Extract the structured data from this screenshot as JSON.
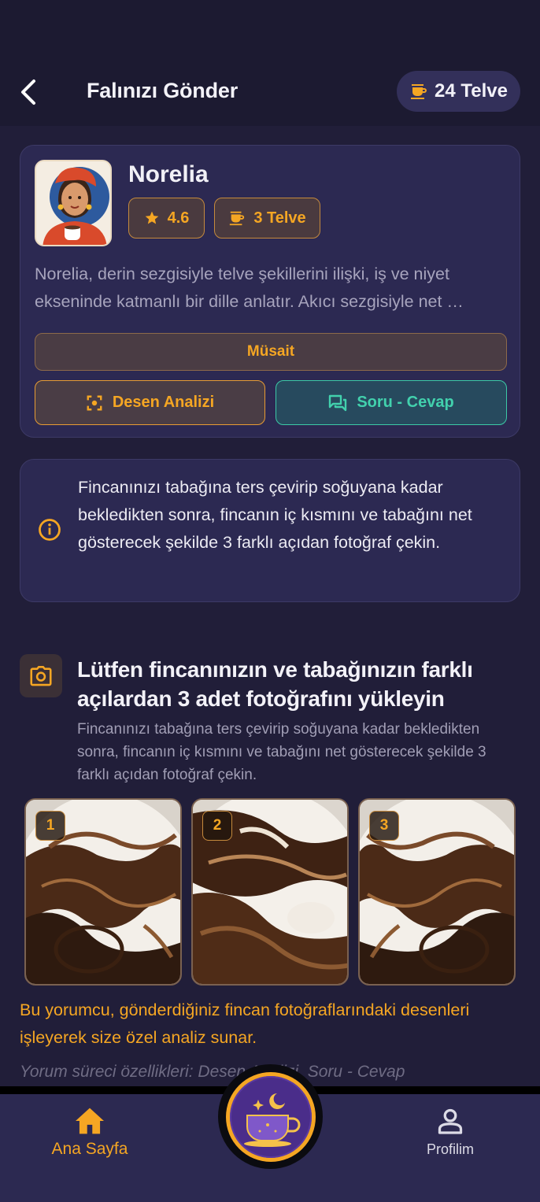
{
  "header": {
    "title": "Falınızı Gönder",
    "balance": "24 Telve",
    "back_icon": "chevron-left-icon",
    "balance_icon": "coffee-cup-icon"
  },
  "reader": {
    "name": "Norelia",
    "rating": "4.6",
    "price": "3 Telve",
    "description_line1": "Norelia, derin sezgisiyle telve şekillerini ilişki, iş ve niyet",
    "description_line2": "ekseninde katmanlı bir dille anlatır. Akıcı sezgisiyle net …",
    "status": "Müsait",
    "pattern_button": "Desen Analizi",
    "qa_button": "Soru - Cevap"
  },
  "info": {
    "text": "Fincanınızı tabağına ters çevirip soğuyana kadar bekledikten sonra, fincanın iç kısmını ve tabağını net gösterecek şekilde 3 farklı açıdan fotoğraf çekin."
  },
  "upload": {
    "title": "Lütfen fincanınızın ve tabağınızın farklı açılardan 3 adet fotoğrafını yükleyin",
    "subtitle": "Fincanınızı tabağına ters çevirip soğuyana kadar bekledikten sonra, fincanın iç kısmını ve tabağını net gösterecek şekilde 3 farklı açıdan fotoğraf çekin.",
    "photos": [
      {
        "number": "1"
      },
      {
        "number": "2"
      },
      {
        "number": "3"
      }
    ]
  },
  "note": "Bu yorumcu, gönderdiğiniz fincan fotoğraflarındaki desenleri işleyerek size özel analiz sunar.",
  "features": "Yorum süreci özellikleri: Desen Analizi, Soru - Cevap",
  "bottom_nav": {
    "home": "Ana Sayfa",
    "profile": "Profilim"
  },
  "colors": {
    "accent": "#f5a623",
    "teal": "#42d1ad",
    "background": "#211e39",
    "card": "#2c2952"
  }
}
